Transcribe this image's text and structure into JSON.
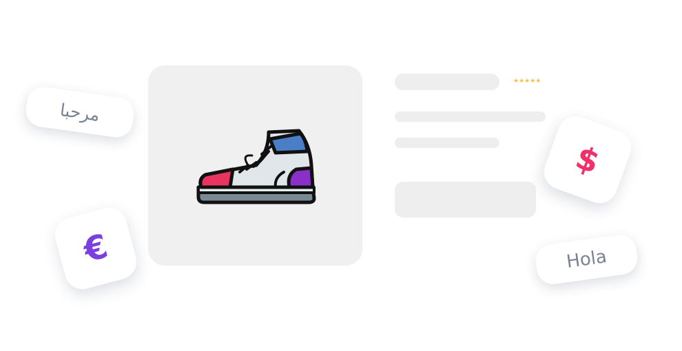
{
  "product": {
    "image_icon": "high-top-sneaker",
    "rating_stars": "★★★★★",
    "rating_value": 5,
    "rating_max": 5
  },
  "languages": {
    "arabic_label": "مرحبا",
    "spanish_label": "Hola"
  },
  "currencies": {
    "euro_symbol": "€",
    "dollar_symbol": "$"
  },
  "colors": {
    "card_bg": "#f0f0f0",
    "skeleton": "#eeeeee",
    "star": "#f5c048",
    "euro": "#7b3fe0",
    "dollar": "#f0306a",
    "chip_text": "#7a8295"
  }
}
